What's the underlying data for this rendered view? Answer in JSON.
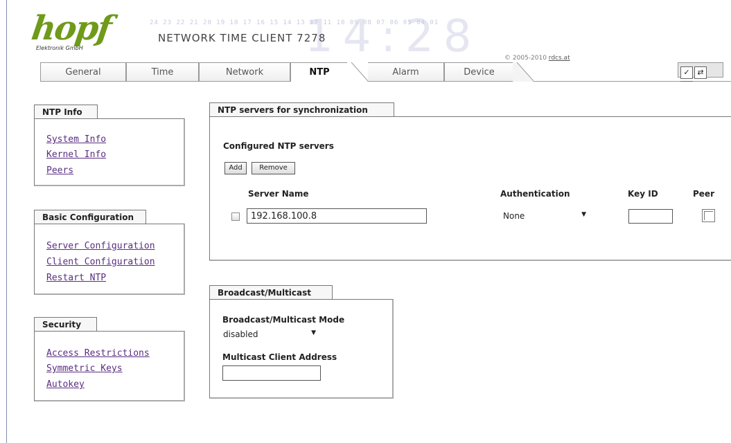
{
  "header": {
    "logo_text": "hopf",
    "logo_sub": "Elektronik   GmbH",
    "ticker": "24 23 22 21 20 19 18 17 16 15 14 13 12 11 10 09 08 07 06 05 04 01",
    "product_title": "NETWORK TIME CLIENT 7278",
    "clock_watermark": "14:28",
    "copyright_prefix": "© 2005-2010",
    "copyright_link": "rdcs.at"
  },
  "tabs": [
    {
      "label": "General",
      "active": false
    },
    {
      "label": "Time",
      "active": false
    },
    {
      "label": "Network",
      "active": false
    },
    {
      "label": "NTP",
      "active": true
    },
    {
      "label": "Alarm",
      "active": false
    },
    {
      "label": "Device",
      "active": false
    }
  ],
  "toolbar": {
    "icons": [
      "check-icon",
      "refresh-icon",
      "save-icon"
    ],
    "glyphs": [
      "✓",
      "⇄",
      "▢"
    ]
  },
  "sidebar": {
    "ntp_info": {
      "title": "NTP Info",
      "links": [
        "System Info",
        "Kernel Info",
        "Peers"
      ]
    },
    "basic_config": {
      "title": "Basic Configuration",
      "links": [
        "Server Configuration",
        "Client Configuration",
        "Restart NTP"
      ]
    },
    "security": {
      "title": "Security",
      "links": [
        "Access Restrictions",
        "Symmetric Keys",
        "Autokey"
      ]
    }
  },
  "servers": {
    "title": "NTP servers for synchronization",
    "subtitle": "Configured NTP servers",
    "add_label": "Add",
    "remove_label": "Remove",
    "columns": {
      "server_name": "Server Name",
      "authentication": "Authentication",
      "key_id": "Key ID",
      "peer": "Peer"
    },
    "rows": [
      {
        "selected": false,
        "server": "192.168.100.8",
        "authentication": "None",
        "key_id": "",
        "peer": false
      }
    ]
  },
  "broadcast": {
    "title": "Broadcast/Multicast",
    "mode_label": "Broadcast/Multicast Mode",
    "mode_value": "disabled",
    "address_label": "Multicast Client Address",
    "address_value": ""
  },
  "colors": {
    "logo_green": "#6f9a1a",
    "link_purple": "#5a2d82",
    "border": "#777777"
  }
}
